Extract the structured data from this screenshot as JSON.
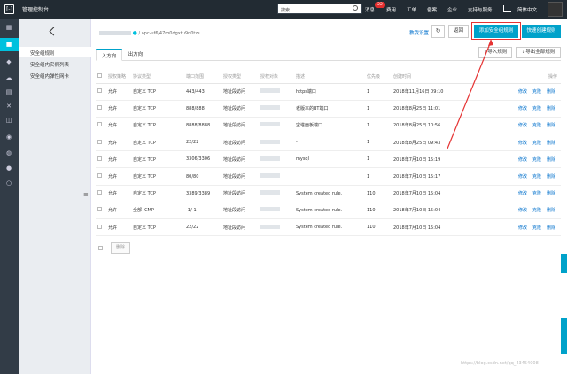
{
  "topbar": {
    "title": "管理控制台",
    "search_placeholder": "搜索",
    "nav": [
      "消息",
      "费用",
      "工单",
      "备案",
      "企业",
      "支持与服务"
    ],
    "badge": "22",
    "lang": "简体中文"
  },
  "sidebar": {
    "items": [
      "安全组规则",
      "安全组内实例列表",
      "安全组内弹性网卡"
    ]
  },
  "breadcrumb": {
    "vpc": "vpc-uf6j47ro0dgxtu9n0tzs"
  },
  "toolbar": {
    "help": "教我设置",
    "back": "返回",
    "add_rule": "添加安全组规则",
    "quick_add": "快速创建规则",
    "import": "导入规则",
    "export": "导出全部规则"
  },
  "tabs": [
    "入方向",
    "出方向"
  ],
  "table": {
    "headers": [
      "授权策略",
      "协议类型",
      "端口范围",
      "授权类型",
      "授权对象",
      "描述",
      "优先级",
      "创建时间",
      "操作"
    ],
    "rows": [
      [
        "允许",
        "自定义 TCP",
        "443/443",
        "地址段访问",
        "https端口",
        "1",
        "2018年11月16日 09:10"
      ],
      [
        "允许",
        "自定义 TCP",
        "888/888",
        "地址段访问",
        "老版本的BT端口",
        "1",
        "2018年8月25日 11:01"
      ],
      [
        "允许",
        "自定义 TCP",
        "8888/8888",
        "地址段访问",
        "宝塔面板端口",
        "1",
        "2018年8月25日 10:56"
      ],
      [
        "允许",
        "自定义 TCP",
        "22/22",
        "地址段访问",
        "-",
        "1",
        "2018年8月25日 09:43"
      ],
      [
        "允许",
        "自定义 TCP",
        "3306/3306",
        "地址段访问",
        "mysql",
        "1",
        "2018年7月10日 15:19"
      ],
      [
        "允许",
        "自定义 TCP",
        "80/80",
        "地址段访问",
        "",
        "1",
        "2018年7月10日 15:17"
      ],
      [
        "允许",
        "自定义 TCP",
        "3389/3389",
        "地址段访问",
        "System created rule.",
        "110",
        "2018年7月10日 15:04"
      ],
      [
        "允许",
        "全部 ICMP",
        "-1/-1",
        "地址段访问",
        "System created rule.",
        "110",
        "2018年7月10日 15:04"
      ],
      [
        "允许",
        "自定义 TCP",
        "22/22",
        "地址段访问",
        "System created rule.",
        "110",
        "2018年7月10日 15:04"
      ]
    ],
    "ops": [
      "修改",
      "克隆",
      "删除"
    ]
  },
  "footer": {
    "delete": "删除"
  },
  "watermark": "https://blog.csdn.net/qq_43454008"
}
